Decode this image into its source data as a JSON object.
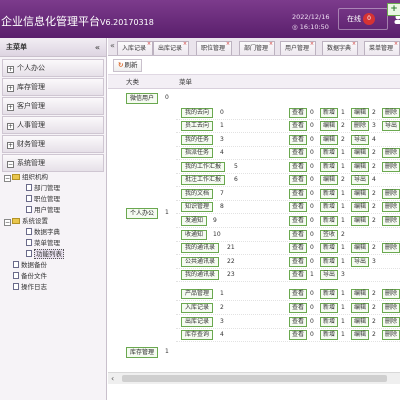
{
  "header": {
    "title": "企业信息化管理平台",
    "version": "V6.20170318",
    "date": "2022/12/16",
    "time": "◎ 16:10:50",
    "online_label": "在线",
    "online_count": "0",
    "brand_color": "#6a2a7c"
  },
  "sidebar": {
    "title": "主菜单",
    "collapse_icon": "«",
    "menus": [
      {
        "label": "个人办公",
        "icon": "expand-box-icon"
      },
      {
        "label": "库存管理",
        "icon": "expand-box-icon"
      },
      {
        "label": "客户管理",
        "icon": "expand-box-icon"
      },
      {
        "label": "人事管理",
        "icon": "expand-box-icon"
      },
      {
        "label": "财务管理",
        "icon": "expand-box-icon"
      },
      {
        "label": "系统管理",
        "icon": "expand-box-icon"
      }
    ],
    "tree": {
      "org": "组织机构",
      "dept": "部门管理",
      "post": "职位管理",
      "user": "用户管理",
      "settings": "系统设置",
      "dict": "数据字典",
      "menu": "菜单管理",
      "func": "功能列表",
      "backup": "数据备份",
      "backup_file": "备份文件",
      "oplog": "操作日志"
    }
  },
  "tabs": [
    "入库记录",
    "出库记录",
    "职位管理",
    "部门管理",
    "用户管理",
    "数据字典",
    "菜单管理"
  ],
  "toolbar": {
    "refresh": "刷新",
    "add": "+"
  },
  "table": {
    "col_category": "大类",
    "col_menu": "菜单",
    "cat_wechat": "微信用户",
    "cat_wechat_count": "0",
    "cat_office": "个人办公",
    "cat_office_count": "1",
    "cat_stock": "库存管理",
    "cat_stock_count": "1",
    "rows": [
      {
        "name": "我的去向",
        "num": "0",
        "acts": [
          {
            "l": "查看",
            "n": "0"
          },
          {
            "l": "新增",
            "n": "1"
          },
          {
            "l": "编辑",
            "n": "2"
          },
          {
            "l": "删除",
            "n": "3"
          }
        ]
      },
      {
        "name": "员工去向",
        "num": "1",
        "acts": [
          {
            "l": "查看",
            "n": "0"
          },
          {
            "l": "编辑",
            "n": "2"
          },
          {
            "l": "删除",
            "n": "3"
          },
          {
            "l": "导出",
            "n": "4"
          }
        ]
      },
      {
        "name": "我的任务",
        "num": "3",
        "acts": [
          {
            "l": "查看",
            "n": "0"
          },
          {
            "l": "编辑",
            "n": "2"
          },
          {
            "l": "导出",
            "n": "4"
          }
        ]
      },
      {
        "name": "指派任务",
        "num": "4",
        "acts": [
          {
            "l": "查看",
            "n": "0"
          },
          {
            "l": "新增",
            "n": "1"
          },
          {
            "l": "编辑",
            "n": "2"
          },
          {
            "l": "删除",
            "n": "3"
          }
        ]
      },
      {
        "name": "我的工作汇报",
        "num": "5",
        "acts": [
          {
            "l": "查看",
            "n": "0"
          },
          {
            "l": "新增",
            "n": "1"
          },
          {
            "l": "编辑",
            "n": "2"
          },
          {
            "l": "删除",
            "n": "3"
          }
        ]
      },
      {
        "name": "批注工作汇报",
        "num": "6",
        "acts": [
          {
            "l": "查看",
            "n": "0"
          },
          {
            "l": "编辑",
            "n": "2"
          },
          {
            "l": "导出",
            "n": "4"
          }
        ]
      },
      {
        "name": "我的文档",
        "num": "7",
        "acts": [
          {
            "l": "查看",
            "n": "0"
          },
          {
            "l": "新增",
            "n": "1"
          },
          {
            "l": "编辑",
            "n": "2"
          },
          {
            "l": "删除",
            "n": "3"
          }
        ]
      },
      {
        "name": "知识管理",
        "num": "8",
        "acts": [
          {
            "l": "查看",
            "n": "0"
          },
          {
            "l": "新增",
            "n": "1"
          },
          {
            "l": "编辑",
            "n": "2"
          },
          {
            "l": "删除",
            "n": "3"
          }
        ]
      },
      {
        "name": "发通知",
        "num": "9",
        "acts": [
          {
            "l": "查看",
            "n": "0"
          },
          {
            "l": "新增",
            "n": "1"
          },
          {
            "l": "编辑",
            "n": "2"
          },
          {
            "l": "删除",
            "n": "3"
          }
        ]
      },
      {
        "name": "收通知",
        "num": "10",
        "acts": [
          {
            "l": "查看",
            "n": "0"
          },
          {
            "l": "签收",
            "n": "2"
          }
        ]
      },
      {
        "name": "我的通讯录",
        "num": "21",
        "acts": [
          {
            "l": "查看",
            "n": "0"
          },
          {
            "l": "新增",
            "n": "1"
          },
          {
            "l": "编辑",
            "n": "2"
          },
          {
            "l": "删除",
            "n": "3"
          }
        ]
      },
      {
        "name": "公共通讯录",
        "num": "22",
        "acts": [
          {
            "l": "查看",
            "n": "0"
          },
          {
            "l": "新增",
            "n": "1"
          },
          {
            "l": "导出",
            "n": "3"
          }
        ]
      },
      {
        "name": "我的通讯录",
        "num": "23",
        "acts": [
          {
            "l": "查看",
            "n": "1"
          },
          {
            "l": "导出",
            "n": "3"
          }
        ]
      },
      {
        "name": "产品管理",
        "num": "1",
        "acts": [
          {
            "l": "查看",
            "n": "0"
          },
          {
            "l": "新增",
            "n": "1"
          },
          {
            "l": "编辑",
            "n": "2"
          },
          {
            "l": "删除",
            "n": "3"
          }
        ]
      },
      {
        "name": "入库记录",
        "num": "2",
        "acts": [
          {
            "l": "查看",
            "n": "0"
          },
          {
            "l": "新增",
            "n": "1"
          },
          {
            "l": "编辑",
            "n": "2"
          },
          {
            "l": "删除",
            "n": "3"
          }
        ]
      },
      {
        "name": "出库记录",
        "num": "3",
        "acts": [
          {
            "l": "查看",
            "n": "0"
          },
          {
            "l": "新增",
            "n": "1"
          },
          {
            "l": "编辑",
            "n": "2"
          },
          {
            "l": "删除",
            "n": "3"
          }
        ]
      },
      {
        "name": "库存查询",
        "num": "4",
        "acts": [
          {
            "l": "查看",
            "n": "0"
          },
          {
            "l": "新增",
            "n": "1"
          },
          {
            "l": "编辑",
            "n": "2"
          },
          {
            "l": "删除",
            "n": "3"
          }
        ]
      }
    ]
  }
}
